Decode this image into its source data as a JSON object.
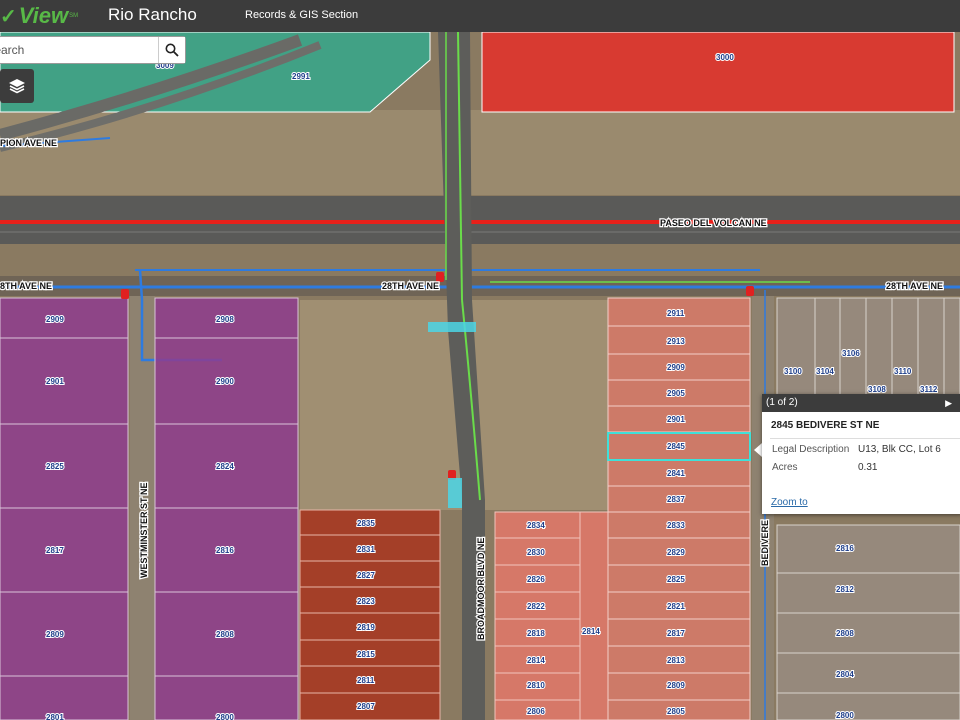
{
  "header": {
    "brand_check": "✓",
    "brand_word": "View",
    "brand_tm": "SM",
    "city": "Rio Rancho",
    "section": "Records & GIS Section"
  },
  "search": {
    "placeholder": "ss Search",
    "icon": "search-icon"
  },
  "layers_button": {
    "icon": "layers-icon"
  },
  "roads": {
    "paseo": "PASEO DEL VOLCAN NE",
    "ave28_left": "8TH AVE NE",
    "ave28_mid": "28TH AVE NE",
    "ave28_right": "28TH AVE NE",
    "pion": "PION AVE NE",
    "westminster": "WESTMINSTER ST NE",
    "broadmoor": "BROADMOOR BLVD NE",
    "bedivere": "BEDIVERE"
  },
  "parcels": {
    "top_green": "2991",
    "top_green2": "3009",
    "top_red": "3000",
    "p2909": "2909",
    "p2901": "2901",
    "p2825": "2825",
    "p2817": "2817",
    "p2809": "2809",
    "p2801": "2801",
    "p2908": "2908",
    "p2900": "2900",
    "p2824": "2824",
    "p2816": "2816",
    "p2808": "2808",
    "p2800": "2800",
    "r2835": "2835",
    "r2831": "2831",
    "r2827": "2827",
    "r2823": "2823",
    "r2819": "2819",
    "r2815": "2815",
    "r2811": "2811",
    "r2807": "2807",
    "s2834": "2834",
    "s2830": "2830",
    "s2826": "2826",
    "s2822": "2822",
    "s2818": "2818",
    "s2814": "2814",
    "s2810": "2810",
    "s2806": "2806",
    "s2814b": "2814",
    "t2911": "2911",
    "t2913": "2913",
    "t2909": "2909",
    "t2905": "2905",
    "t2901": "2901",
    "t2845": "2845",
    "t2841": "2841",
    "t2837": "2837",
    "t2833": "2833",
    "t2829": "2829",
    "t2825": "2825",
    "t2821": "2821",
    "t2817": "2817",
    "t2813": "2813",
    "t2809": "2809",
    "t2805": "2805",
    "g3100": "3100",
    "g3104": "3104",
    "g3106": "3106",
    "g3108": "3108",
    "g3110": "3110",
    "g3112": "3112",
    "g2816": "2816",
    "g2812": "2812",
    "g2808": "2808",
    "g2804": "2804",
    "g2800": "2800"
  },
  "popup": {
    "counter": "(1 of 2)",
    "next_icon": "▶",
    "title": "2845 BEDIVERE ST NE",
    "rows": [
      {
        "key": "Legal Description",
        "value": "U13, Blk CC, Lot 6"
      },
      {
        "key": "Acres",
        "value": "0.31"
      }
    ],
    "zoom": "Zoom to"
  },
  "colors": {
    "header": "#3c3c3c",
    "brand": "#58b947",
    "purple": "#8e3c8e",
    "dark_red": "#a8351f",
    "salmon": "#e8786a",
    "pink": "#d9857a",
    "grey_parcel": "#9a8f86",
    "green_parcel": "#3aa38a",
    "red_parcel": "#e0342a",
    "paseo_line": "#e8201a",
    "water_line": "#2e7be0",
    "green_line": "#6adc4a"
  }
}
